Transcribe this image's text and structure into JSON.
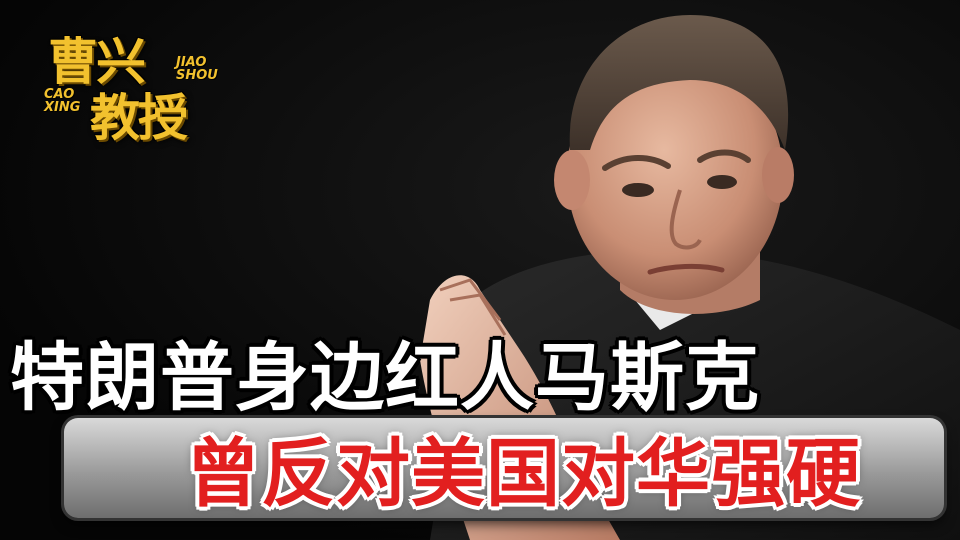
{
  "logo": {
    "line1": "曹兴",
    "line2": "教授",
    "en_left": "CAO XING",
    "en_right": "JIAO SHOU"
  },
  "headline": {
    "line1": "特朗普身边红人马斯克",
    "line2": "曾反对美国对华强硬"
  },
  "colors": {
    "background": "#0b0b0b",
    "logo_gold": "#f2c12e",
    "headline_white": "#ffffff",
    "headline_red": "#e21f1f",
    "banner_gray": "#9a9a9a"
  }
}
